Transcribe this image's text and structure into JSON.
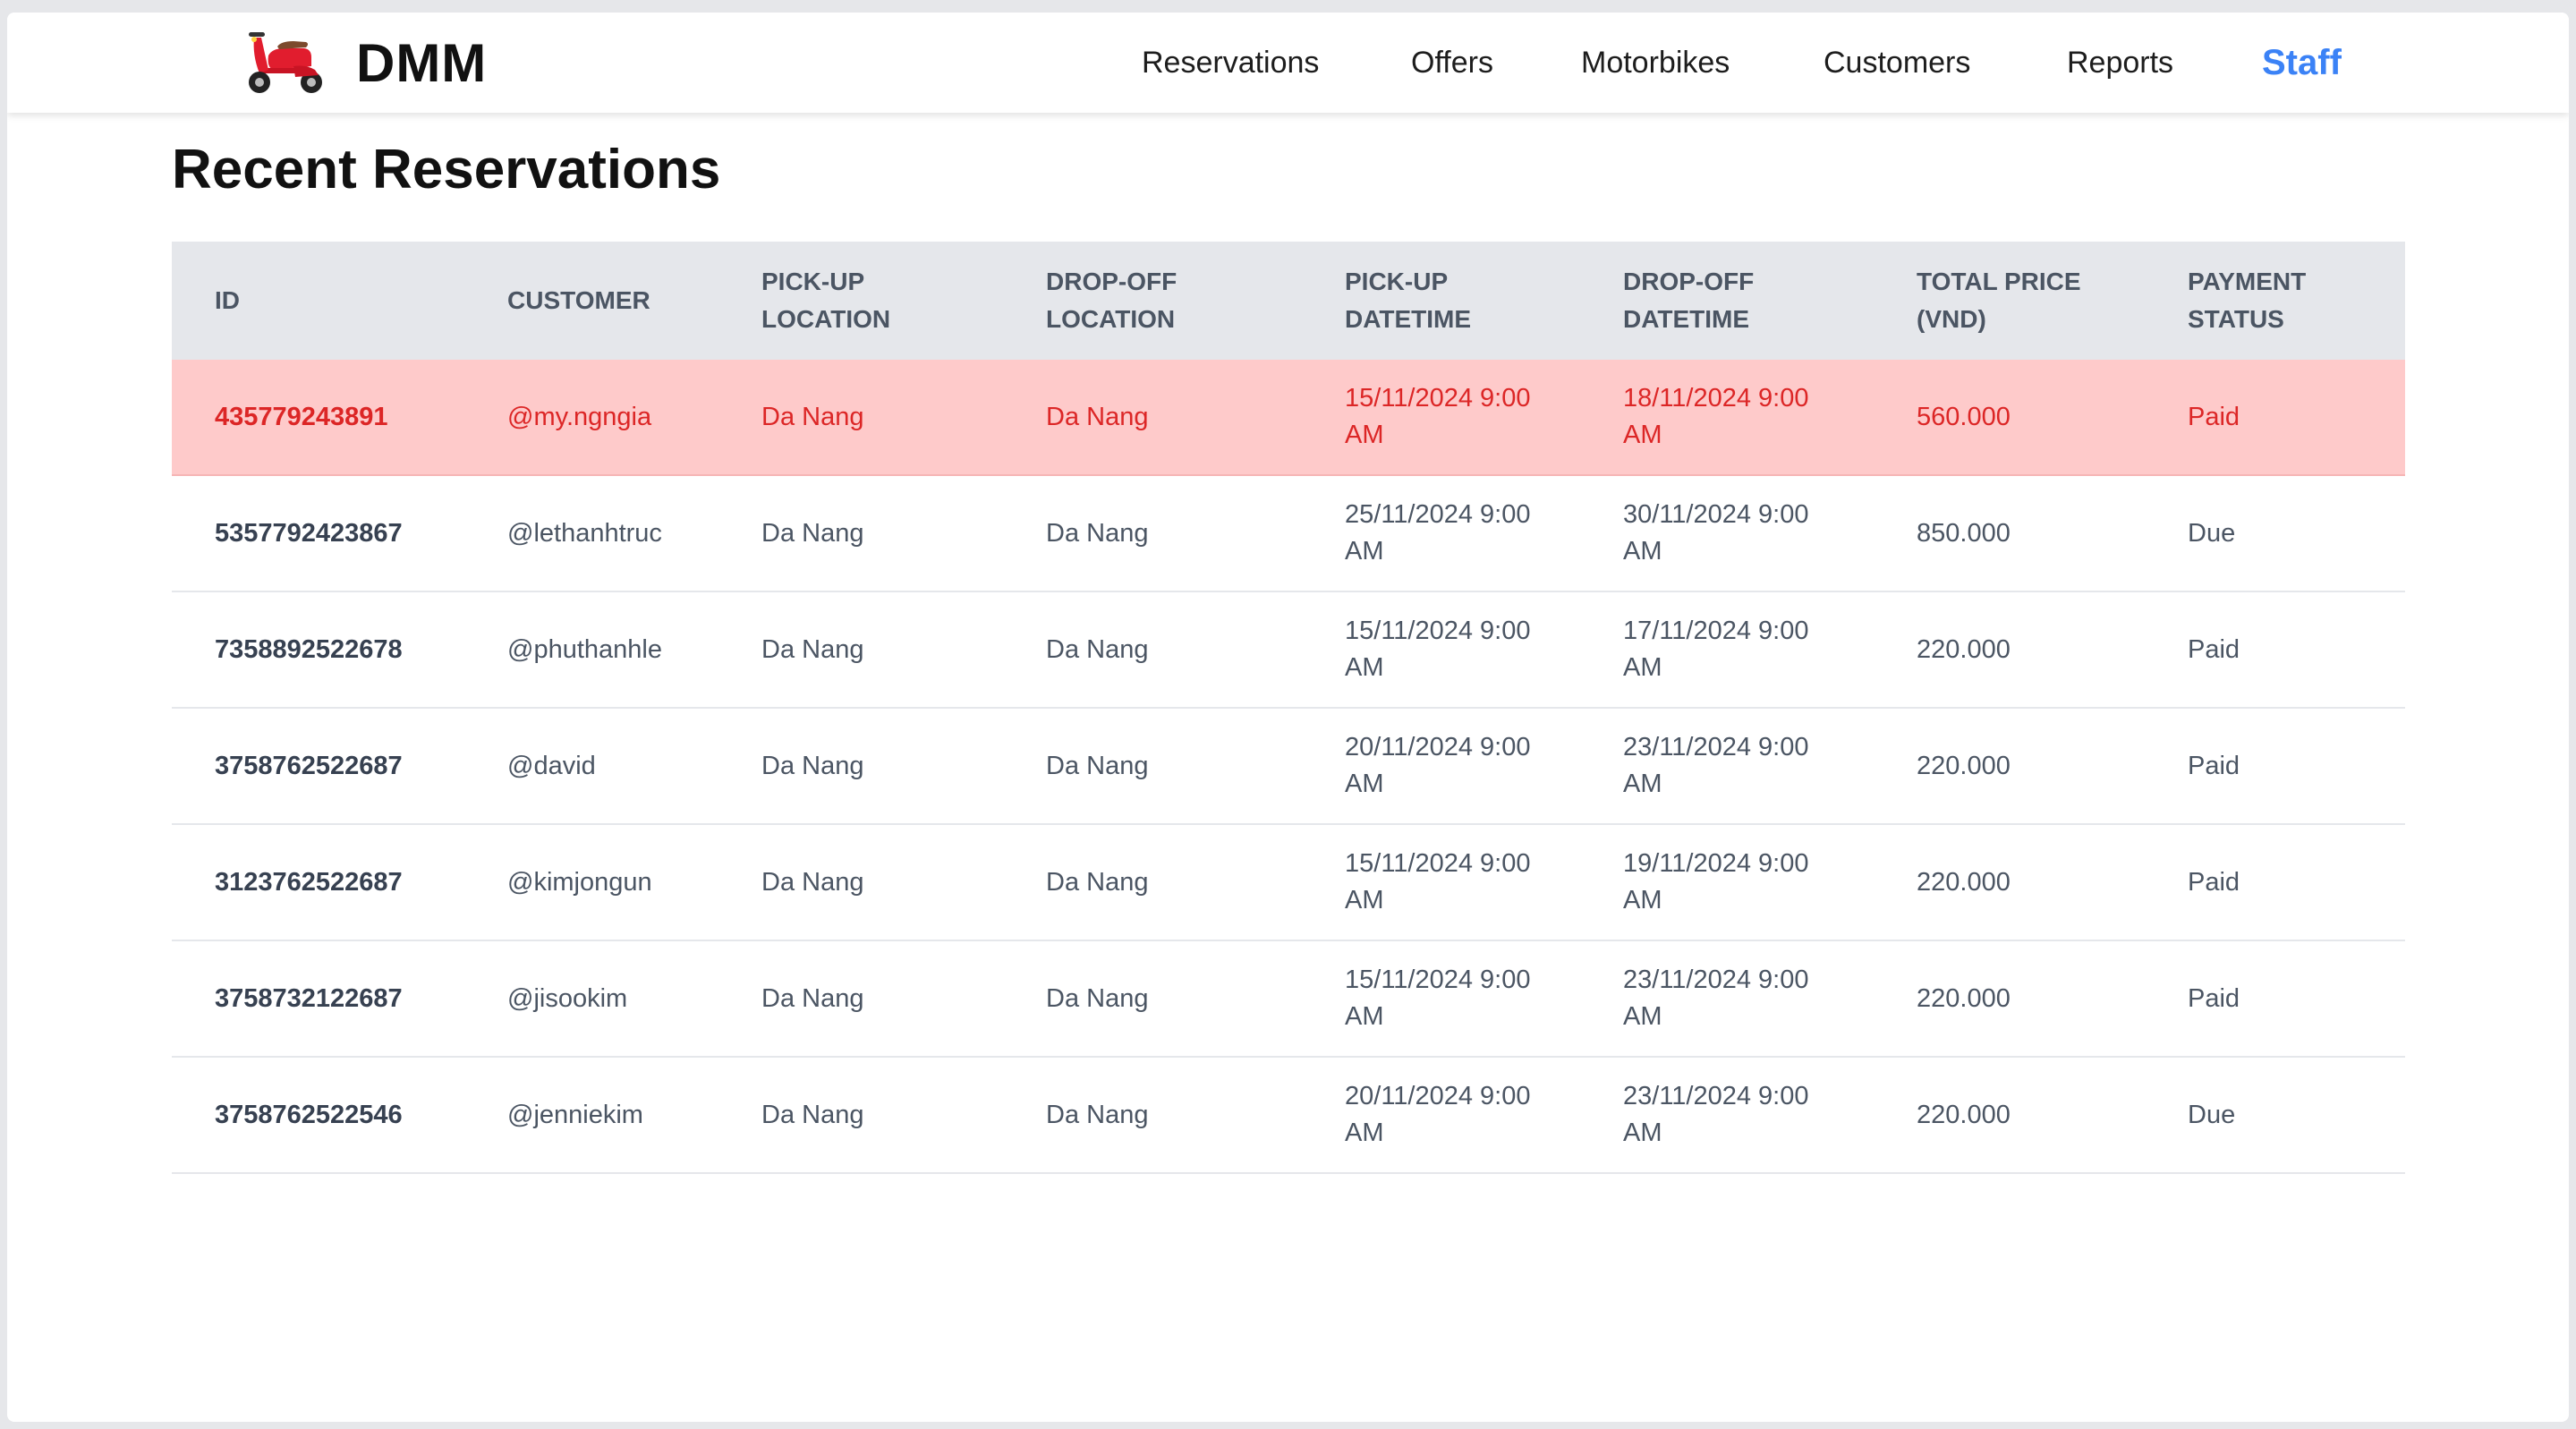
{
  "brand": {
    "name": "DMM",
    "logo_icon": "scooter-icon",
    "logo_color": "#e11d2e"
  },
  "nav": {
    "items": [
      {
        "label": "Reservations",
        "active": false
      },
      {
        "label": "Offers",
        "active": false
      },
      {
        "label": "Motorbikes",
        "active": false
      },
      {
        "label": "Customers",
        "active": false
      },
      {
        "label": "Reports",
        "active": false
      },
      {
        "label": "Staff",
        "active": true
      }
    ],
    "active_color": "#3b82f6"
  },
  "page": {
    "title": "Recent Reservations"
  },
  "table": {
    "headers": {
      "id": "ID",
      "customer": "CUSTOMER",
      "pickup_location": [
        "PICK-UP",
        "LOCATION"
      ],
      "dropoff_location": [
        "DROP-OFF",
        "LOCATION"
      ],
      "pickup_datetime": [
        "PICK-UP",
        "DATETIME"
      ],
      "dropoff_datetime": [
        "DROP-OFF",
        "DATETIME"
      ],
      "total_price": [
        "TOTAL PRICE",
        "(VND)"
      ],
      "payment_status": [
        "PAYMENT",
        "STATUS"
      ]
    },
    "rows": [
      {
        "id": "435779243891",
        "customer": "@my.ngngia",
        "pickup_location": "Da Nang",
        "dropoff_location": "Da Nang",
        "pickup_datetime": "15/11/2024 9:00 AM",
        "dropoff_datetime": "18/11/2024 9:00 AM",
        "total_price": "560.000",
        "payment_status": "Paid",
        "highlighted": true
      },
      {
        "id": "5357792423867",
        "customer": "@lethanhtruc",
        "pickup_location": "Da Nang",
        "dropoff_location": "Da Nang",
        "pickup_datetime": "25/11/2024 9:00 AM",
        "dropoff_datetime": "30/11/2024 9:00 AM",
        "total_price": "850.000",
        "payment_status": "Due",
        "highlighted": false
      },
      {
        "id": "7358892522678",
        "customer": "@phuthanhle",
        "pickup_location": "Da Nang",
        "dropoff_location": "Da Nang",
        "pickup_datetime": "15/11/2024 9:00 AM",
        "dropoff_datetime": "17/11/2024 9:00 AM",
        "total_price": "220.000",
        "payment_status": "Paid",
        "highlighted": false
      },
      {
        "id": "3758762522687",
        "customer": "@david",
        "pickup_location": "Da Nang",
        "dropoff_location": "Da Nang",
        "pickup_datetime": "20/11/2024 9:00 AM",
        "dropoff_datetime": "23/11/2024 9:00 AM",
        "total_price": "220.000",
        "payment_status": "Paid",
        "highlighted": false
      },
      {
        "id": "3123762522687",
        "customer": "@kimjongun",
        "pickup_location": "Da Nang",
        "dropoff_location": "Da Nang",
        "pickup_datetime": "15/11/2024 9:00 AM",
        "dropoff_datetime": "19/11/2024 9:00 AM",
        "total_price": "220.000",
        "payment_status": "Paid",
        "highlighted": false
      },
      {
        "id": "3758732122687",
        "customer": "@jisookim",
        "pickup_location": "Da Nang",
        "dropoff_location": "Da Nang",
        "pickup_datetime": "15/11/2024 9:00 AM",
        "dropoff_datetime": "23/11/2024 9:00 AM",
        "total_price": "220.000",
        "payment_status": "Paid",
        "highlighted": false
      },
      {
        "id": "3758762522546",
        "customer": "@jenniekim",
        "pickup_location": "Da Nang",
        "dropoff_location": "Da Nang",
        "pickup_datetime": "20/11/2024 9:00 AM",
        "dropoff_datetime": "23/11/2024 9:00 AM",
        "total_price": "220.000",
        "payment_status": "Due",
        "highlighted": false
      }
    ],
    "highlight_bg": "#fecaca",
    "highlight_text": "#dc2626"
  }
}
